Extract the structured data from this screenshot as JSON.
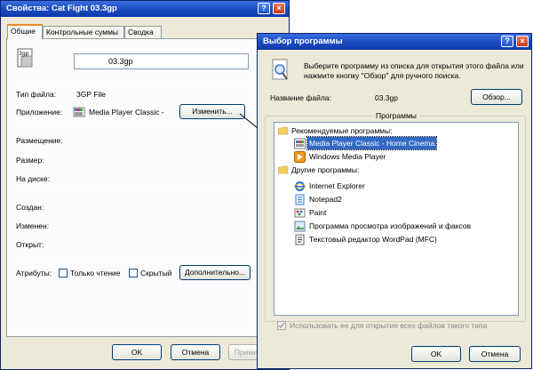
{
  "props": {
    "title": "Свойства: Cat Fight 03.3gp",
    "tabs": [
      "Общие",
      "Контрольные суммы",
      "Сводка"
    ],
    "file_icon_text": "3gp",
    "file_name": "03.3gp",
    "type_label": "Тип файла:",
    "type_value": "3GP File",
    "app_label": "Приложение:",
    "app_value": "Media Player Classic -",
    "change_button": "Изменить...",
    "location_label": "Размещение:",
    "size_label": "Размер:",
    "disk_label": "На диске:",
    "created_label": "Создан:",
    "modified_label": "Изменен:",
    "opened_label": "Открыт:",
    "attrs_label": "Атрибуты:",
    "readonly_label": "Только чтение",
    "hidden_label": "Скрытый",
    "advanced_button": "Дополнительно...",
    "ok_button": "OK",
    "cancel_button": "Отмена",
    "apply_button": "Приме"
  },
  "chooser": {
    "title": "Выбор программы",
    "description": "Выберите программу из списка для открытия этого файла или нажмите кнопку \"Обзор\" для ручного поиска.",
    "filename_label": "Название файла:",
    "filename_value": "03.3gp",
    "browse_button": "Обзор...",
    "programs_group": "Программы",
    "recommended_header": "Рекомендуемые программы:",
    "recommended": [
      {
        "name": "Media Player Classic - Home Cinema",
        "icon": "film-icon",
        "selected": true
      },
      {
        "name": "Windows Media Player",
        "icon": "play-icon",
        "selected": false
      }
    ],
    "other_header": "Другие программы:",
    "other": [
      {
        "name": "Internet Explorer",
        "icon": "ie-icon"
      },
      {
        "name": "Notepad2",
        "icon": "notepad-icon"
      },
      {
        "name": "Paint",
        "icon": "paint-icon"
      },
      {
        "name": "Программа просмотра изображений и факсов",
        "icon": "image-viewer-icon"
      },
      {
        "name": "Текстовый редактор WordPad (MFC)",
        "icon": "wordpad-icon"
      }
    ],
    "always_use_label": "Использовать ее для открытия всех файлов такого типа",
    "ok_button": "OK",
    "cancel_button": "Отмена"
  },
  "colors": {
    "title_blue": "#1f4fc3",
    "selection": "#316ac5",
    "folder": "#f3cf60"
  }
}
